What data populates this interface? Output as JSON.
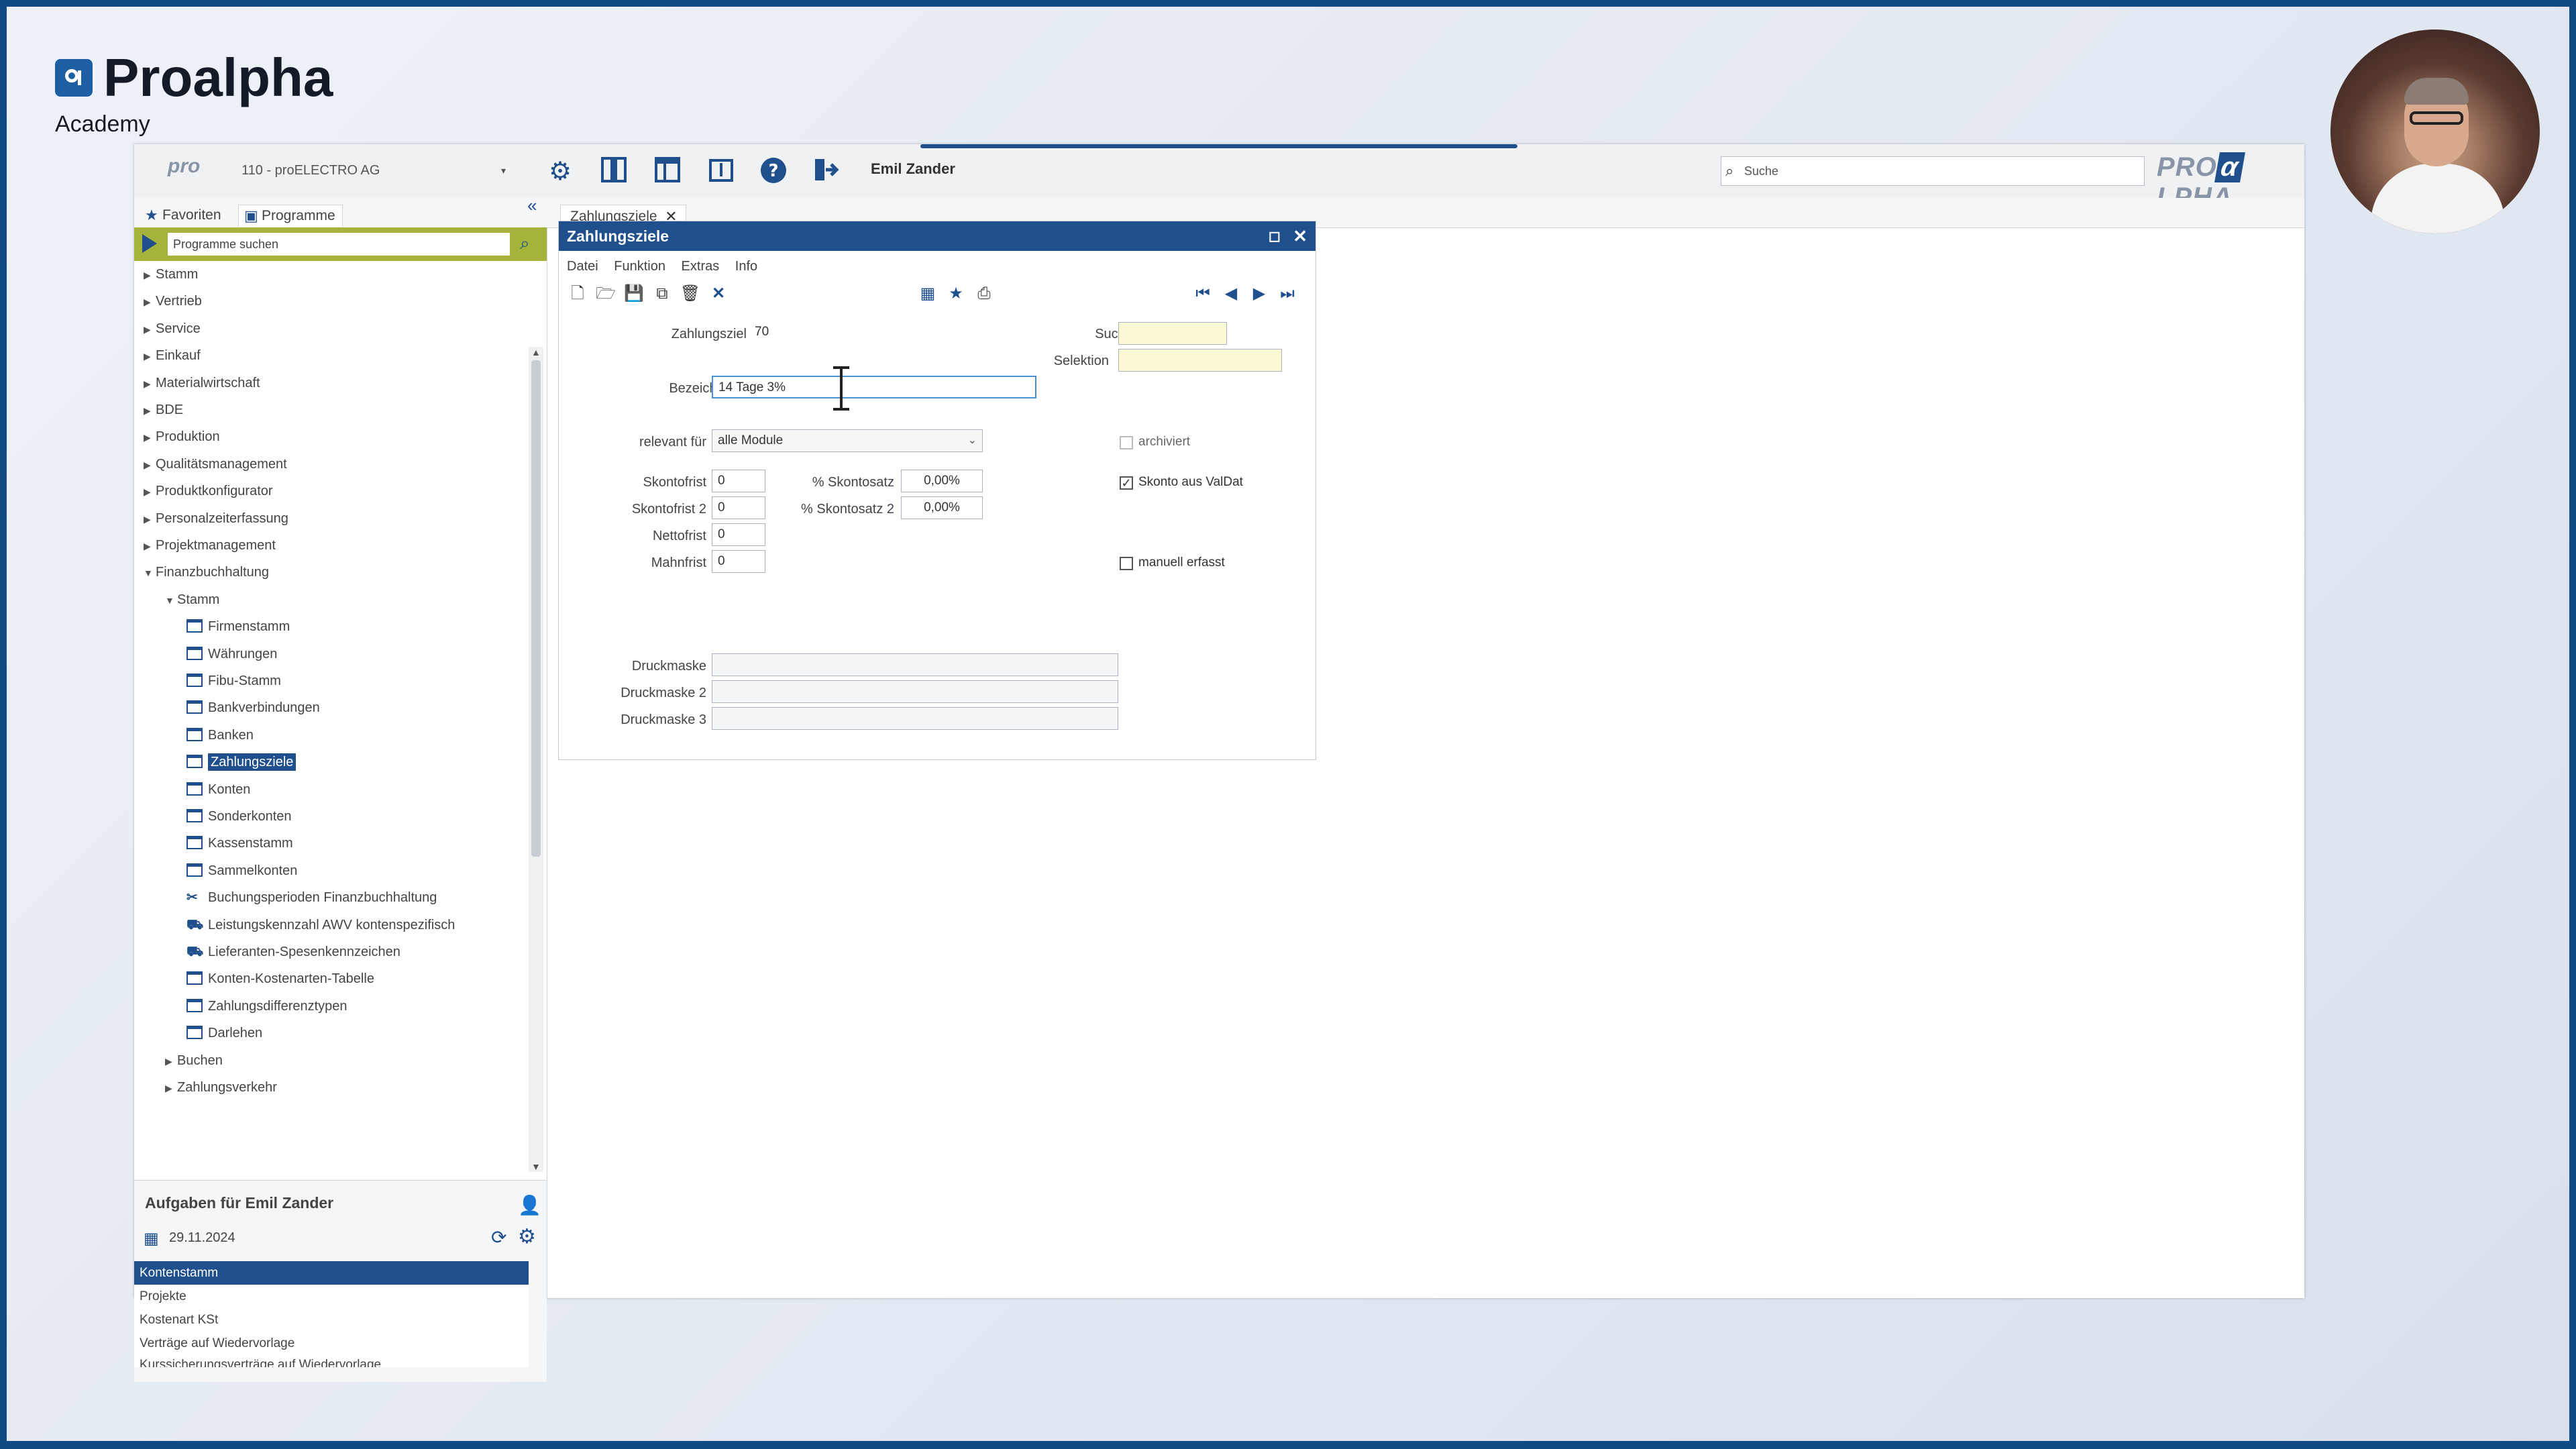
{
  "brand": {
    "name": "Proalpha",
    "subtitle": "Academy"
  },
  "topbar": {
    "pro_mark": "pro",
    "company": "110 - proELECTRO AG",
    "user": "Emil Zander",
    "search_placeholder": "Suche",
    "brand_pre": "PRO",
    "brand_alpha": "α",
    "brand_post": "LPHA",
    "icons": [
      "gear-icon",
      "panel-icon",
      "layout-icon",
      "info-book-icon",
      "help-icon",
      "logout-icon"
    ]
  },
  "sidebar": {
    "tabs": [
      {
        "label": "Favoriten",
        "icon": "star-icon"
      },
      {
        "label": "Programme",
        "icon": "programs-icon"
      }
    ],
    "search_placeholder": "Programme suchen",
    "tree": [
      {
        "label": "Stamm",
        "level": 0,
        "state": "collapsed"
      },
      {
        "label": "Vertrieb",
        "level": 0,
        "state": "collapsed"
      },
      {
        "label": "Service",
        "level": 0,
        "state": "collapsed"
      },
      {
        "label": "Einkauf",
        "level": 0,
        "state": "collapsed"
      },
      {
        "label": "Materialwirtschaft",
        "level": 0,
        "state": "collapsed"
      },
      {
        "label": "BDE",
        "level": 0,
        "state": "collapsed"
      },
      {
        "label": "Produktion",
        "level": 0,
        "state": "collapsed"
      },
      {
        "label": "Qualitätsmanagement",
        "level": 0,
        "state": "collapsed"
      },
      {
        "label": "Produktkonfigurator",
        "level": 0,
        "state": "collapsed"
      },
      {
        "label": "Personalzeiterfassung",
        "level": 0,
        "state": "collapsed"
      },
      {
        "label": "Projektmanagement",
        "level": 0,
        "state": "collapsed"
      },
      {
        "label": "Finanzbuchhaltung",
        "level": 0,
        "state": "expanded"
      },
      {
        "label": "Stamm",
        "level": 1,
        "state": "expanded"
      },
      {
        "label": "Firmenstamm",
        "level": 2,
        "state": "program"
      },
      {
        "label": "Währungen",
        "level": 2,
        "state": "program"
      },
      {
        "label": "Fibu-Stamm",
        "level": 2,
        "state": "program"
      },
      {
        "label": "Bankverbindungen",
        "level": 2,
        "state": "program"
      },
      {
        "label": "Banken",
        "level": 2,
        "state": "program"
      },
      {
        "label": "Zahlungsziele",
        "level": 2,
        "state": "program",
        "selected": true
      },
      {
        "label": "Konten",
        "level": 2,
        "state": "program"
      },
      {
        "label": "Sonderkonten",
        "level": 2,
        "state": "program"
      },
      {
        "label": "Kassenstamm",
        "level": 2,
        "state": "program"
      },
      {
        "label": "Sammelkonten",
        "level": 2,
        "state": "program"
      },
      {
        "label": "Buchungsperioden Finanzbuchhaltung",
        "level": 2,
        "state": "tool"
      },
      {
        "label": "Leistungskennzahl AWV kontenspezifisch",
        "level": 2,
        "state": "truck"
      },
      {
        "label": "Lieferanten-Spesenkennzeichen",
        "level": 2,
        "state": "truck"
      },
      {
        "label": "Konten-Kostenarten-Tabelle",
        "level": 2,
        "state": "program"
      },
      {
        "label": "Zahlungsdifferenztypen",
        "level": 2,
        "state": "program"
      },
      {
        "label": "Darlehen",
        "level": 2,
        "state": "program"
      },
      {
        "label": "Buchen",
        "level": 1,
        "state": "collapsed"
      },
      {
        "label": "Zahlungsverkehr",
        "level": 1,
        "state": "collapsed"
      }
    ]
  },
  "tasks": {
    "title": "Aufgaben für Emil Zander",
    "date": "29.11.2024",
    "items": [
      "Kontenstamm",
      "Projekte",
      "Kostenart KSt",
      "Verträge auf Wiedervorlage",
      "Kurssicherungsverträge auf Wiedervorlage"
    ]
  },
  "doc_tab": {
    "label": "Zahlungsziele"
  },
  "dialog": {
    "title": "Zahlungsziele",
    "menu": [
      "Datei",
      "Funktion",
      "Extras",
      "Info"
    ],
    "labels": {
      "zahlungsziel": "Zahlungsziel",
      "bezeichnung": "Bezeichnung",
      "relevant": "relevant für",
      "skontofrist": "Skontofrist",
      "skontofrist2": "Skontofrist 2",
      "nettofrist": "Nettofrist",
      "mahnfrist": "Mahnfrist",
      "skontosatz": "% Skontosatz",
      "skontosatz2": "% Skontosatz 2",
      "suchbegriff": "Suchbegriff",
      "selektion": "Selektion",
      "archiviert": "archiviert",
      "skonto_valdat": "Skonto aus ValDat",
      "manuell": "manuell erfasst",
      "druckmaske": "Druckmaske",
      "druckmaske2": "Druckmaske 2",
      "druckmaske3": "Druckmaske 3"
    },
    "values": {
      "zahlungsziel": "70",
      "bezeichnung": "14 Tage 3%",
      "relevant": "alle Module",
      "skontofrist": "0",
      "skontofrist2": "0",
      "nettofrist": "0",
      "mahnfrist": "0",
      "skontosatz": "0,00%",
      "skontosatz2": "0,00%",
      "suchbegriff": "",
      "selektion": "",
      "druckmaske": "",
      "druckmaske2": "",
      "druckmaske3": ""
    },
    "checks": {
      "archiviert": false,
      "skonto_valdat": true,
      "manuell": false
    }
  }
}
